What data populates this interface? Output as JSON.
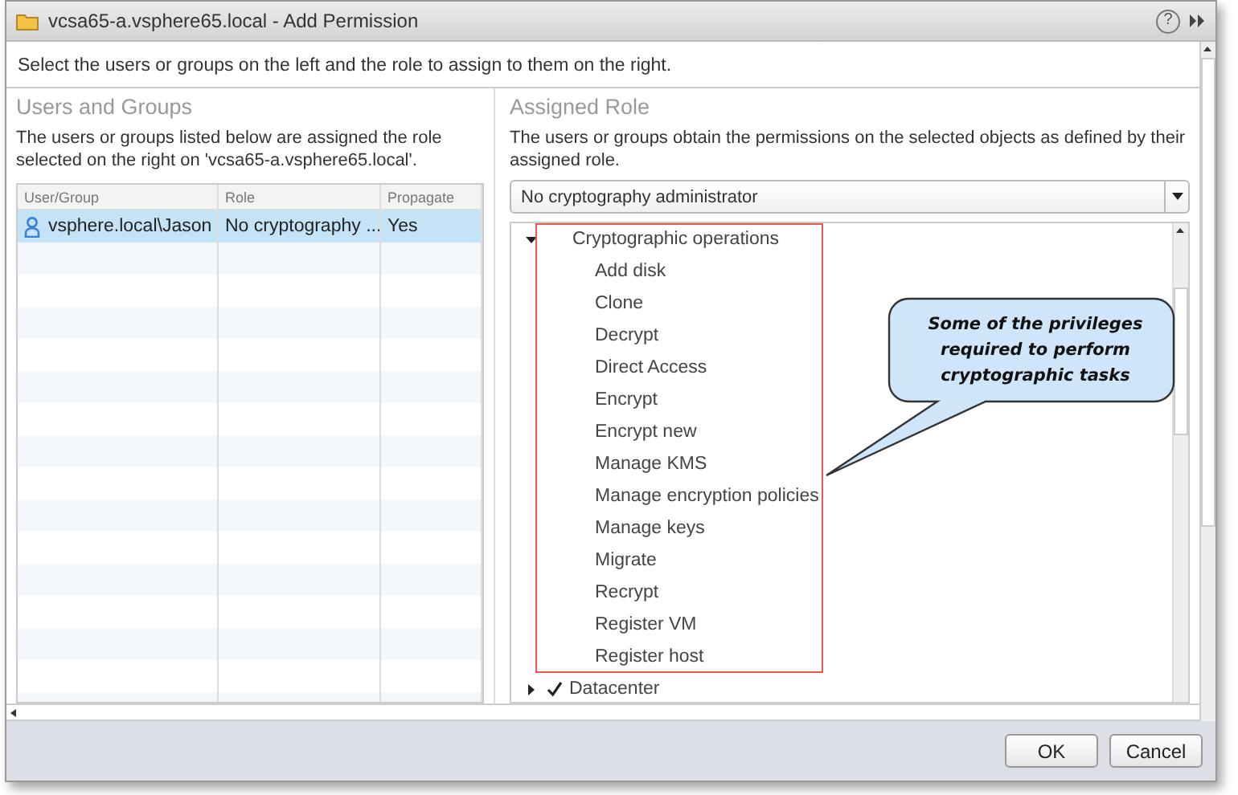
{
  "window": {
    "title": "vcsa65-a.vsphere65.local - Add Permission",
    "help": "?"
  },
  "instruction": "Select the users or groups on the left and the role to assign to them on the right.",
  "users_and_groups": {
    "heading": "Users and Groups",
    "description": "The users or groups listed below are assigned the role selected on the right on 'vcsa65-a.vsphere65.local'.",
    "table": {
      "columns": [
        "User/Group",
        "Role",
        "Propagate"
      ],
      "rows": [
        {
          "user": "vsphere.local\\Jason",
          "role": "No cryptography ...",
          "propagate": "Yes",
          "selected": true
        }
      ]
    }
  },
  "assigned_role": {
    "heading": "Assigned Role",
    "description": "The users or groups obtain the permissions on the selected objects as defined by their assigned role.",
    "role_dropdown": {
      "value": "No cryptography administrator"
    },
    "privileges": [
      {
        "label": "Cryptographic operations",
        "expanded": true,
        "checked": false,
        "children": [
          {
            "label": "Add disk"
          },
          {
            "label": "Clone"
          },
          {
            "label": "Decrypt"
          },
          {
            "label": "Direct Access"
          },
          {
            "label": "Encrypt"
          },
          {
            "label": "Encrypt new"
          },
          {
            "label": "Manage KMS"
          },
          {
            "label": "Manage encryption policies"
          },
          {
            "label": "Manage keys"
          },
          {
            "label": "Migrate"
          },
          {
            "label": "Recrypt"
          },
          {
            "label": "Register VM"
          },
          {
            "label": "Register host"
          }
        ]
      },
      {
        "label": "Datacenter",
        "expanded": false,
        "checked": true
      }
    ]
  },
  "callout": {
    "text": "Some of the privileges required to perform cryptographic tasks"
  },
  "buttons": [
    "OK",
    "Cancel"
  ]
}
